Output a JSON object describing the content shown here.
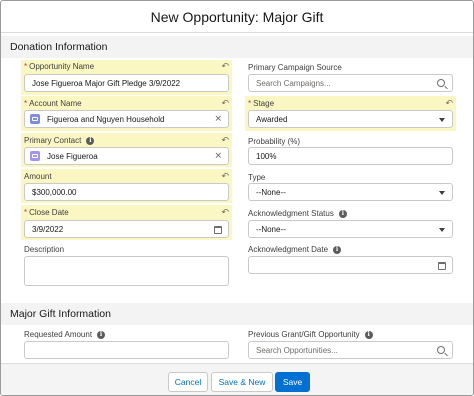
{
  "modal": {
    "title": "New Opportunity: Major Gift"
  },
  "sections": {
    "donation": "Donation Information",
    "major_gift": "Major Gift Information"
  },
  "fields": {
    "opportunity_name": {
      "label": "Opportunity Name",
      "value": "Jose Figueroa Major Gift Pledge 3/9/2022"
    },
    "account_name": {
      "label": "Account Name",
      "value": "Figueroa and Nguyen Household"
    },
    "primary_contact": {
      "label": "Primary Contact",
      "value": "Jose Figueroa"
    },
    "amount": {
      "label": "Amount",
      "value": "$300,000.00"
    },
    "close_date": {
      "label": "Close Date",
      "value": "3/9/2022"
    },
    "description": {
      "label": "Description",
      "value": ""
    },
    "primary_campaign_source": {
      "label": "Primary Campaign Source",
      "placeholder": "Search Campaigns..."
    },
    "stage": {
      "label": "Stage",
      "value": "Awarded"
    },
    "probability": {
      "label": "Probability (%)",
      "value": "100%"
    },
    "type": {
      "label": "Type",
      "value": "--None--"
    },
    "acknowledgment_status": {
      "label": "Acknowledgment Status",
      "value": "--None--"
    },
    "acknowledgment_date": {
      "label": "Acknowledgment Date",
      "value": ""
    },
    "requested_amount": {
      "label": "Requested Amount",
      "value": ""
    },
    "previous_grant": {
      "label": "Previous Grant/Gift Opportunity",
      "placeholder": "Search Opportunities..."
    }
  },
  "footer": {
    "cancel": "Cancel",
    "save_new": "Save & New",
    "save": "Save"
  },
  "colors": {
    "highlight": "#fbf7c3",
    "brand": "#0070d2",
    "required": "#c23934"
  }
}
